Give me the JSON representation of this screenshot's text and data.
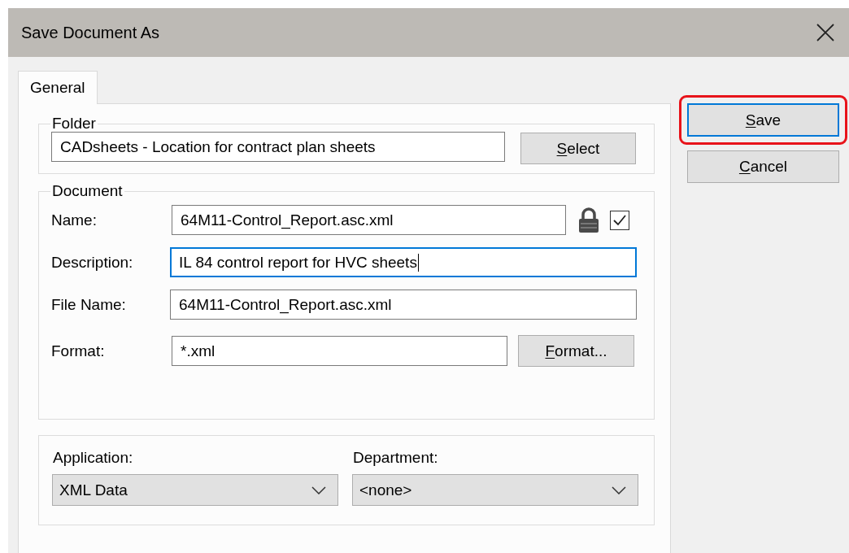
{
  "window": {
    "title": "Save Document As"
  },
  "tabs": [
    {
      "label": "General",
      "selected": true
    }
  ],
  "folder": {
    "label": "Folder",
    "value": "CADsheets - Location for contract plan sheets",
    "button": {
      "label": "Select",
      "first_letter_underlined": true
    }
  },
  "document": {
    "label": "Document",
    "fields": [
      {
        "kind": "locked",
        "label": "Name:",
        "value": "64M11-Control_Report.asc.xml",
        "locked": true,
        "checked": true,
        "focused": false
      },
      {
        "kind": "text",
        "label": "Description:",
        "value": "IL 84 control report for HVC sheets",
        "focused": true
      },
      {
        "kind": "text",
        "label": "File Name:",
        "value": "64M11-Control_Report.asc.xml",
        "focused": false
      },
      {
        "kind": "button",
        "label": "Format:",
        "value": "*.xml",
        "focused": false,
        "button": {
          "label": "Format...",
          "first_letter_underlined": true
        }
      }
    ]
  },
  "application": {
    "label": "Application:",
    "value": "XML Data"
  },
  "department": {
    "label": "Department:",
    "value": "<none>"
  },
  "buttons": [
    {
      "label": "Save",
      "first_letter_underlined": true,
      "default": true,
      "highlighted": true
    },
    {
      "label": "Cancel",
      "first_letter_underlined": true,
      "default": false,
      "highlighted": false
    }
  ]
}
